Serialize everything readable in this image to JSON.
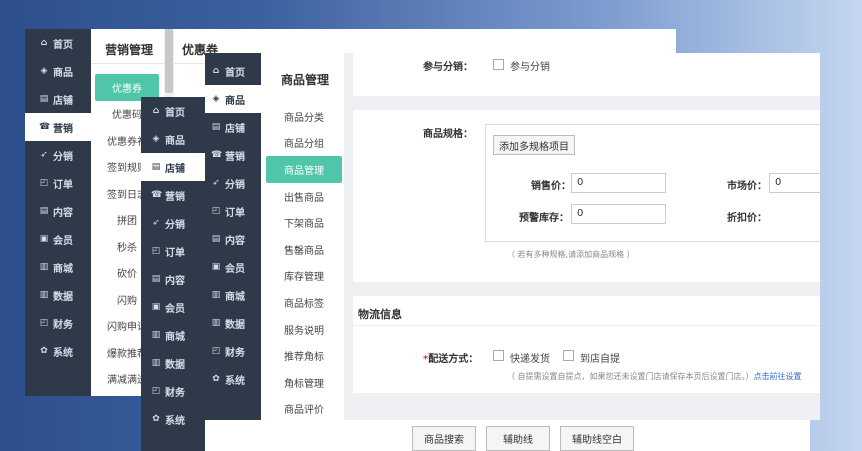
{
  "nav": {
    "items": [
      {
        "label": "首页",
        "icon": "home-icon",
        "glyph": "⌂"
      },
      {
        "label": "商品",
        "icon": "cube-icon",
        "glyph": "◈"
      },
      {
        "label": "店铺",
        "icon": "store-icon",
        "glyph": "▤"
      },
      {
        "label": "营销",
        "icon": "marketing-icon",
        "glyph": "☎"
      },
      {
        "label": "分销",
        "icon": "share-icon",
        "glyph": "➶"
      },
      {
        "label": "订单",
        "icon": "order-icon",
        "glyph": "◰"
      },
      {
        "label": "内容",
        "icon": "content-icon",
        "glyph": "▤"
      },
      {
        "label": "会员",
        "icon": "member-icon",
        "glyph": "▣"
      },
      {
        "label": "商城",
        "icon": "mall-icon",
        "glyph": "▥"
      },
      {
        "label": "数据",
        "icon": "data-icon",
        "glyph": "▥"
      },
      {
        "label": "财务",
        "icon": "finance-icon",
        "glyph": "◰"
      },
      {
        "label": "系统",
        "icon": "settings-icon",
        "glyph": "✿"
      }
    ]
  },
  "win1": {
    "section_title": "营销管理",
    "page_title": "优惠券",
    "menu": [
      "优惠券",
      "优惠码",
      "优惠券礼",
      "签到规则",
      "签到日志",
      "拼团",
      "秒杀",
      "砍价",
      "闪购",
      "闪购申请",
      "爆款推荐",
      "满减满送"
    ]
  },
  "win3": {
    "section_title": "商品管理",
    "menu": [
      "商品分类",
      "商品分组",
      "商品管理",
      "出售商品",
      "下架商品",
      "售罄商品",
      "库存管理",
      "商品标签",
      "服务说明",
      "推荐角标",
      "角标管理",
      "商品评价"
    ]
  },
  "form": {
    "distribution_label": "参与分销：",
    "distribution_option": "参与分销",
    "spec_label": "商品规格：",
    "add_spec_button": "添加多规格项目",
    "price_label": "销售价：",
    "price_value": "0",
    "market_label": "市场价：",
    "market_value": "0",
    "warn_label": "预警库存：",
    "warn_value": "0",
    "discount_label": "折扣价：",
    "spec_hint": "（ 若有多种规格,请添加商品规格 ）",
    "logistics_title": "物流信息",
    "delivery_required": "*",
    "delivery_label": "配送方式：",
    "express_option": "快递发货",
    "pickup_option": "到店自提",
    "delivery_hint": "（ 自提需设置自提点，如果您还未设置门店请保存本页后设置门店。）",
    "delivery_link": "点击前往设置",
    "required_color": "#e4393c",
    "link_color": "#2f6bd8"
  },
  "toolbar": {
    "search_button": "商品搜索",
    "guide_button": "辅助线",
    "guide_blank_button": "辅助线空白"
  }
}
